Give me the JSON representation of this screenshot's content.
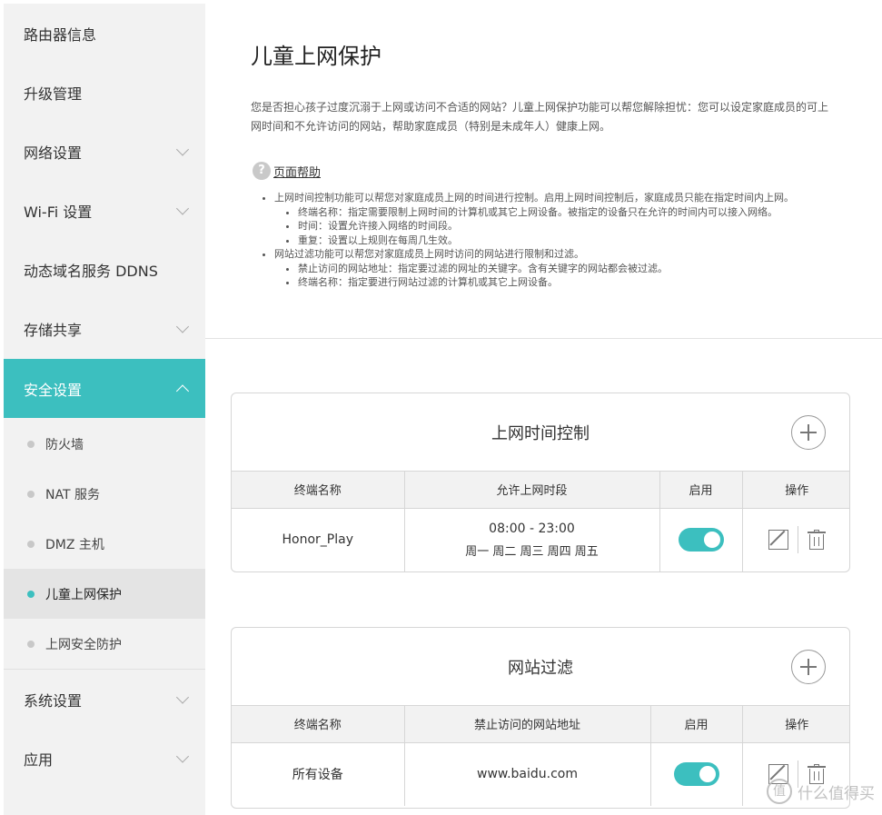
{
  "sidebar": {
    "items": [
      {
        "label": "路由器信息"
      },
      {
        "label": "升级管理"
      },
      {
        "label": "网络设置"
      },
      {
        "label": "Wi-Fi 设置"
      },
      {
        "label": "动态域名服务 DDNS"
      },
      {
        "label": "存储共享"
      },
      {
        "label": "安全设置"
      }
    ],
    "subitems": [
      {
        "label": "防火墙"
      },
      {
        "label": "NAT 服务"
      },
      {
        "label": "DMZ 主机"
      },
      {
        "label": "儿童上网保护"
      },
      {
        "label": "上网安全防护"
      }
    ],
    "bottom_items": [
      {
        "label": "系统设置"
      },
      {
        "label": "应用"
      }
    ]
  },
  "main": {
    "title": "儿童上网保护",
    "intro": "您是否担心孩子过度沉溺于上网或访问不合适的网站？儿童上网保护功能可以帮您解除担忧：您可以设定家庭成员的可上网时间和不允许访问的网站，帮助家庭成员（特别是未成年人）健康上网。",
    "help_label": "页面帮助",
    "help": {
      "p1": "上网时间控制功能可以帮您对家庭成员上网的时间进行控制。启用上网时间控制后，家庭成员只能在指定时间内上网。",
      "p1_sub": [
        "终端名称：指定需要限制上网时间的计算机或其它上网设备。被指定的设备只在允许的时间内可以接入网络。",
        "时间：设置允许接入网络的时间段。",
        "重复：设置以上规则在每周几生效。"
      ],
      "p2": "网站过滤功能可以帮您对家庭成员上网时访问的网站进行限制和过滤。",
      "p2_sub": [
        "禁止访问的网站地址：指定要过滤的网址的关键字。含有关键字的网站都会被过滤。",
        "终端名称：指定要进行网站过滤的计算机或其它上网设备。"
      ]
    }
  },
  "time_control": {
    "title": "上网时间控制",
    "columns": [
      "终端名称",
      "允许上网时段",
      "启用",
      "操作"
    ],
    "rows": [
      {
        "device": "Honor_Play",
        "time": "08:00 - 23:00",
        "days": "周一 周二 周三 周四 周五",
        "enabled": true
      }
    ]
  },
  "site_filter": {
    "title": "网站过滤",
    "columns": [
      "终端名称",
      "禁止访问的网站地址",
      "启用",
      "操作"
    ],
    "rows": [
      {
        "device": "所有设备",
        "url": "www.baidu.com",
        "enabled": true
      }
    ]
  },
  "watermark": {
    "logo": "值",
    "text": "什么值得买"
  },
  "colors": {
    "accent": "#3cbfbf",
    "sidebar_bg": "#f2f2f2"
  }
}
